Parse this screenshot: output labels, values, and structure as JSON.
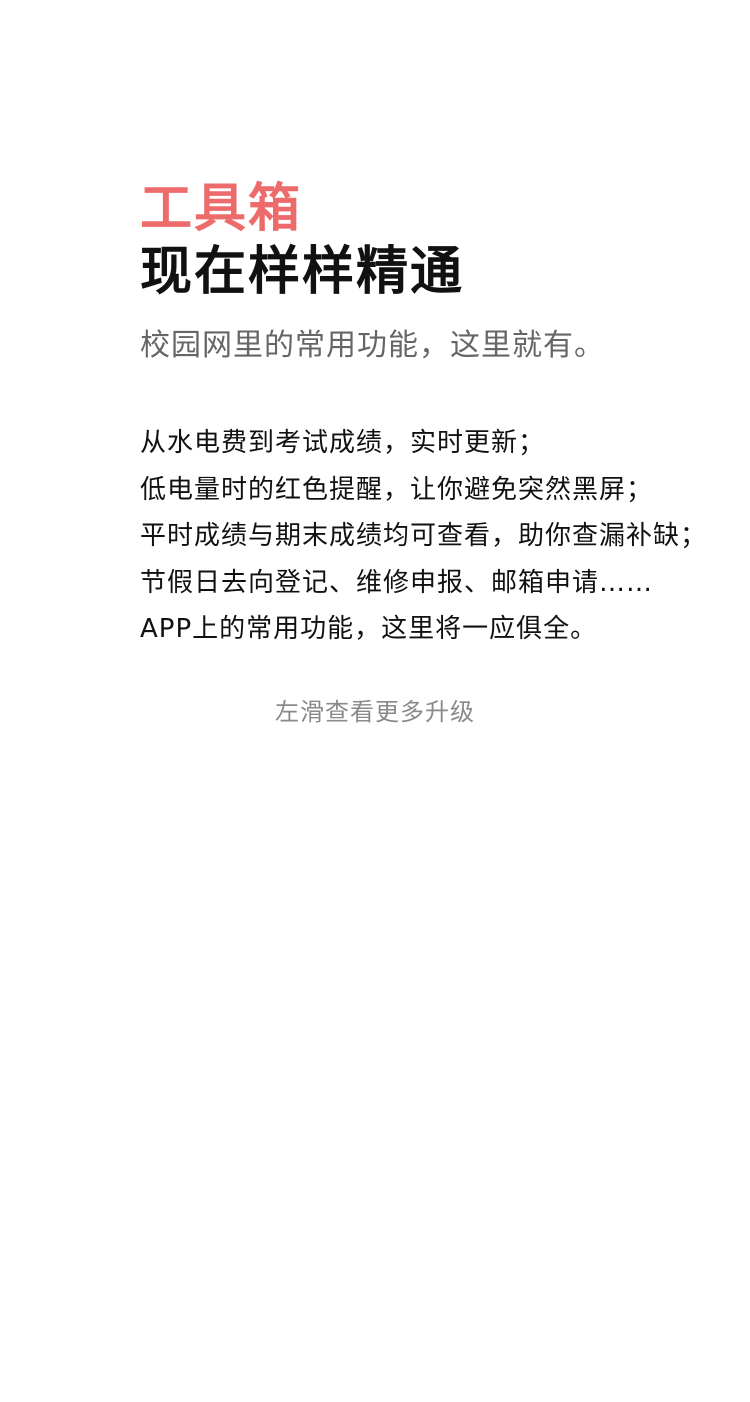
{
  "header": {
    "accent_title": "工具箱",
    "main_title": "现在样样精通",
    "subtitle": "校园网里的常用功能，这里就有。"
  },
  "description": {
    "lines": [
      "从水电费到考试成绩，实时更新；",
      "低电量时的红色提醒，让你避免突然黑屏；",
      "平时成绩与期末成绩均可查看，助你查漏补缺；",
      "节假日去向登记、维修申报、邮箱申请……",
      "APP上的常用功能，这里将一应俱全。"
    ]
  },
  "footer": {
    "swipe_hint": "左滑查看更多升级"
  },
  "colors": {
    "accent": "#ee6b6b",
    "text_primary": "#111111",
    "text_secondary": "#666666",
    "text_hint": "#8a8a8a",
    "background": "#ffffff"
  }
}
